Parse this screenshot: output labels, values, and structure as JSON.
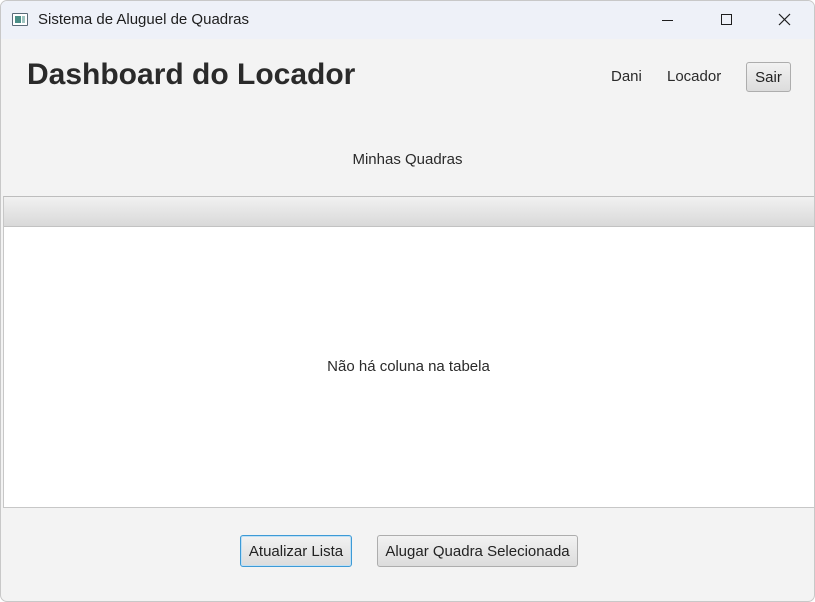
{
  "window": {
    "title": "Sistema de Aluguel de Quadras",
    "controls": [
      "minimize-icon",
      "maximize-icon",
      "close-icon"
    ]
  },
  "header": {
    "title": "Dashboard do Locador",
    "user_name": "Dani",
    "user_role": "Locador",
    "logout_label": "Sair"
  },
  "main": {
    "section_title": "Minhas Quadras",
    "table": {
      "columns": [],
      "rows": [],
      "placeholder": "Não há coluna na tabela"
    }
  },
  "footer": {
    "refresh_label": "Atualizar Lista",
    "rent_label": "Alugar Quadra Selecionada"
  },
  "colors": {
    "focus_accent": "#3d9ad6",
    "window_background": "#f3f3f3",
    "titlebar_background": "#eef1f8"
  }
}
